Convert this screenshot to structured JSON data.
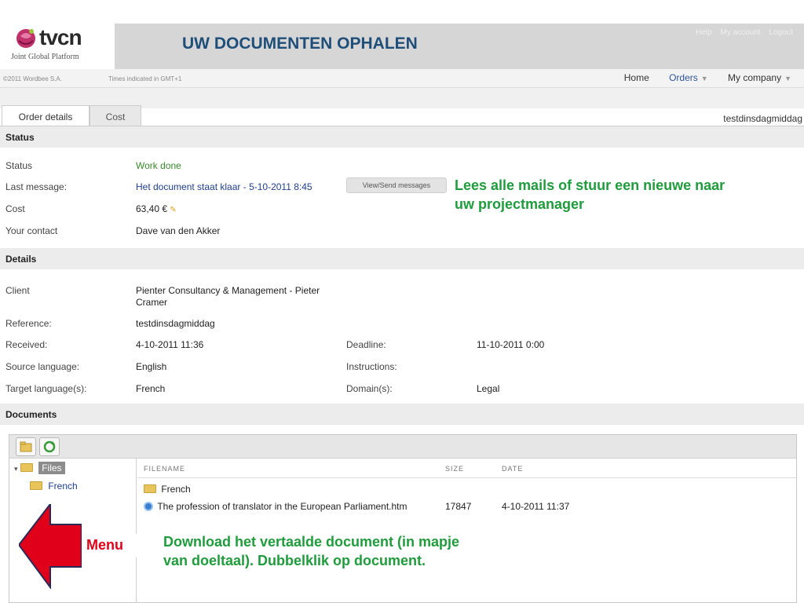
{
  "slide": {
    "title": "UW DOCUMENTEN OPHALEN"
  },
  "logo": {
    "brand": "tvcn",
    "tagline": "Joint Global Platform"
  },
  "top_links": [
    "Help",
    "My account",
    "Logout"
  ],
  "infobar": {
    "copyright": "©2011 Wordbee S.A.",
    "timezone": "Times indicated in GMT+1"
  },
  "nav": {
    "home": "Home",
    "orders": "Orders",
    "company": "My company"
  },
  "tabs": {
    "order_details": "Order details",
    "cost": "Cost",
    "order_name": "testdinsdagmiddag"
  },
  "status_section": {
    "title": "Status",
    "rows": {
      "status_label": "Status",
      "status_value": "Work done",
      "last_message_label": "Last message:",
      "last_message_value": "Het document staat klaar - 5-10-2011 8:45",
      "message_button": "View/Send messages",
      "cost_label": "Cost",
      "cost_value": "63,40 €",
      "contact_label": "Your contact",
      "contact_value": "Dave van den Akker"
    }
  },
  "details_section": {
    "title": "Details",
    "client_label": "Client",
    "client_value_line1": "Pienter Consultancy & Management  -  Pieter",
    "client_value_line2": "Cramer",
    "reference_label": "Reference:",
    "reference_value": "testdinsdagmiddag",
    "received_label": "Received:",
    "received_value": "4-10-2011 11:36",
    "deadline_label": "Deadline:",
    "deadline_value": "11-10-2011 0:00",
    "source_label": "Source language:",
    "source_value": "English",
    "instructions_label": "Instructions:",
    "target_label": "Target language(s):",
    "target_value": "French",
    "domain_label": "Domain(s):",
    "domain_value": "Legal"
  },
  "documents_section": {
    "title": "Documents",
    "tree": {
      "root": "Files",
      "child": "French"
    },
    "columns": {
      "filename": "FILENAME",
      "size": "SIZE",
      "date": "DATE"
    },
    "rows": [
      {
        "name": "French",
        "size": "",
        "date": ""
      },
      {
        "name": "The profession of translator in the European Parliament.htm",
        "size": "17847",
        "date": "4-10-2011 11:37"
      }
    ]
  },
  "annotations": {
    "mail_note_line1": "Lees alle mails of stuur een nieuwe naar",
    "mail_note_line2": "uw projectmanager",
    "download_note_line1": "Download het vertaalde document (in mapje",
    "download_note_line2": "van doeltaal). Dubbelklik op document.",
    "menu_label": "Menu"
  },
  "colors": {
    "title": "#1f4e79",
    "note": "#1f9c3b",
    "arrow": "#e0001a",
    "status_green": "#3a8a2e"
  }
}
